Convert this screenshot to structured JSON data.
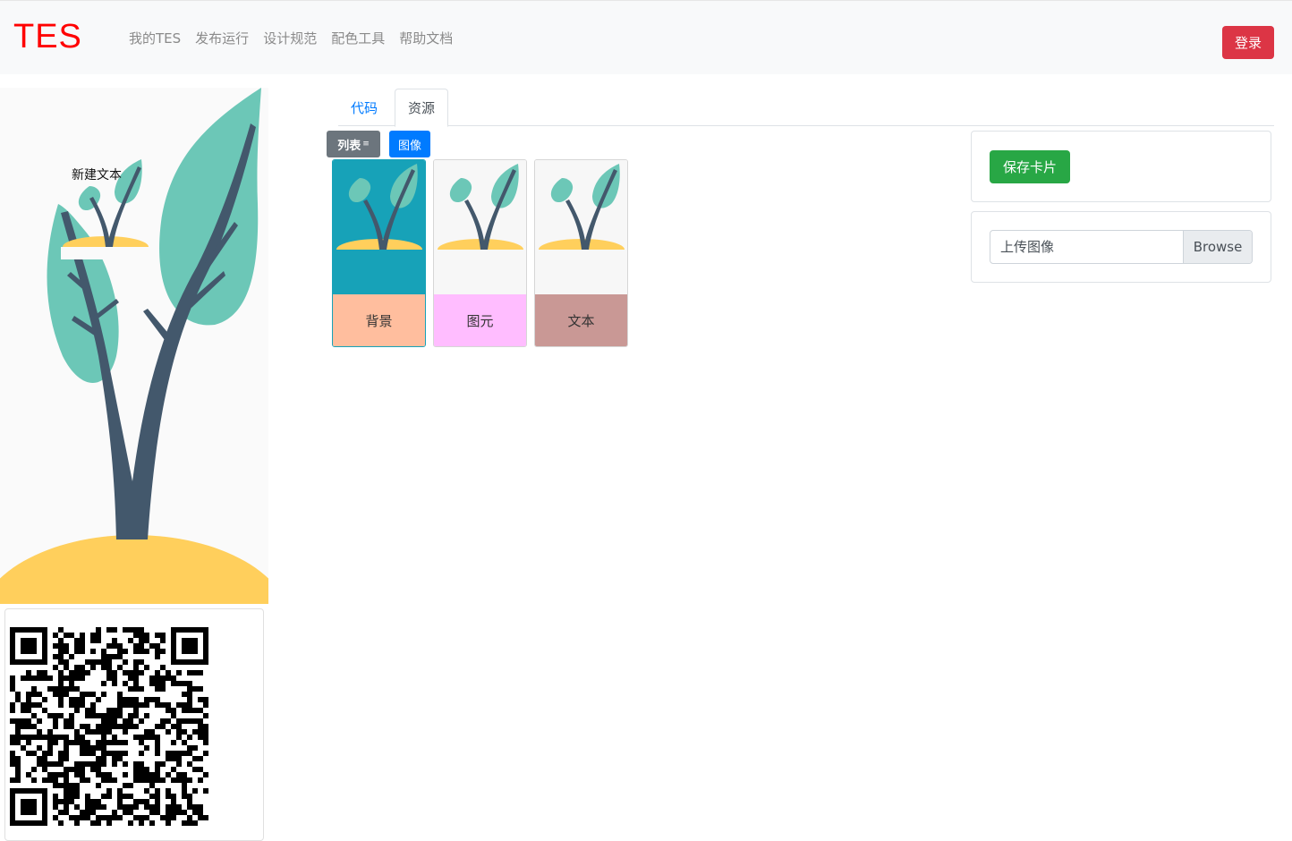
{
  "header": {
    "brand": "TES",
    "nav": [
      "我的TES",
      "发布运行",
      "设计规范",
      "配色工具",
      "帮助文档"
    ],
    "login_label": "登录",
    "colors": {
      "brand": "#ff0000",
      "login": "#dc3545"
    }
  },
  "preview": {
    "text": "新建文本",
    "qr_icon": "qr-code-icon"
  },
  "tabs": [
    {
      "label": "代码",
      "active": false
    },
    {
      "label": "资源",
      "active": true
    }
  ],
  "toolbar": {
    "list_label": "列表",
    "list_caret": "≡",
    "image_label": "图像"
  },
  "resources": [
    {
      "label": "背景",
      "color": "#ffbe9e",
      "thumb_color": "#17a2b8",
      "selected": true
    },
    {
      "label": "图元",
      "color": "#ffbdff",
      "thumb_color": "#f7f7f7",
      "selected": false
    },
    {
      "label": "文本",
      "color": "#c99895",
      "thumb_color": "#f7f7f7",
      "selected": false
    }
  ],
  "sidebar": {
    "save_label": "保存卡片",
    "upload_label": "上传图像",
    "browse_label": "Browse",
    "colors": {
      "save": "#28a745"
    }
  }
}
